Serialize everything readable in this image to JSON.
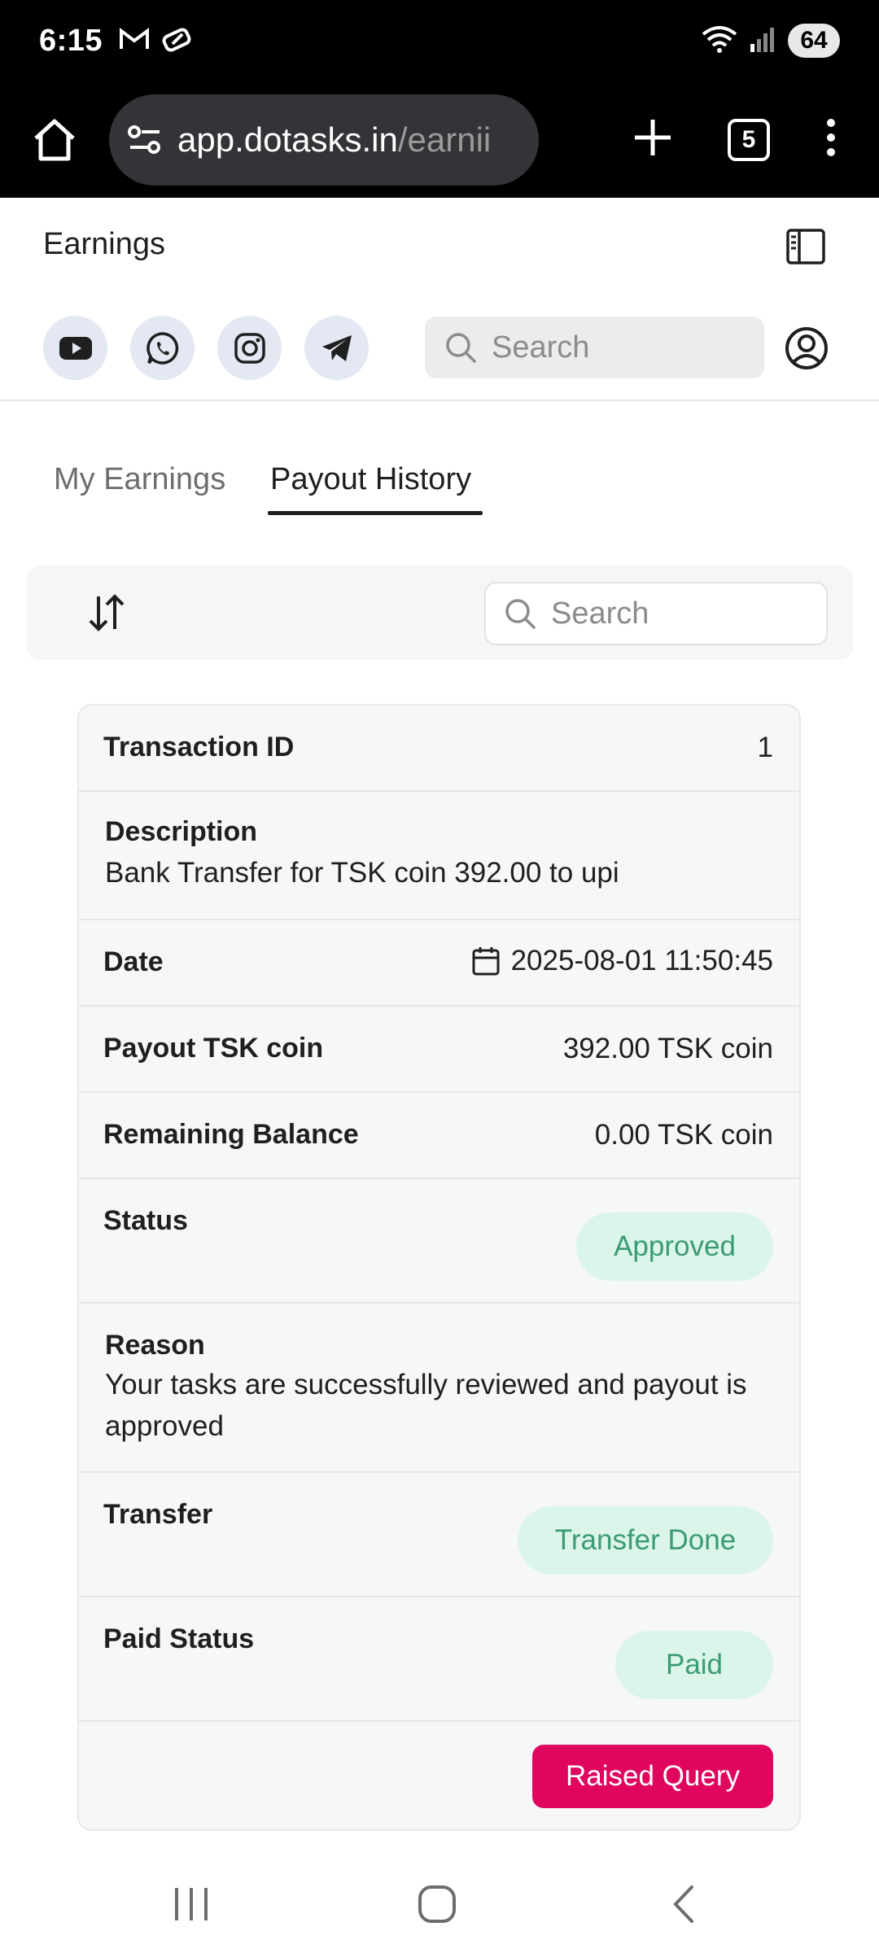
{
  "status_bar": {
    "time": "6:15",
    "battery": "64"
  },
  "browser": {
    "url_domain": "app.dotasks.in",
    "url_path": "/earnii",
    "tab_count": "5"
  },
  "header": {
    "title": "Earnings",
    "search_placeholder": "Search"
  },
  "tabs": [
    {
      "label": "My Earnings",
      "active": false
    },
    {
      "label": "Payout History",
      "active": true
    }
  ],
  "toolbar": {
    "search_placeholder": "Search"
  },
  "payout": {
    "transaction_id_label": "Transaction ID",
    "transaction_id": "1",
    "description_label": "Description",
    "description": "Bank Transfer for TSK coin 392.00 to upi",
    "date_label": "Date",
    "date": "2025-08-01 11:50:45",
    "payout_label": "Payout TSK coin",
    "payout": "392.00 TSK coin",
    "balance_label": "Remaining Balance",
    "balance": "0.00 TSK coin",
    "status_label": "Status",
    "status": "Approved",
    "reason_label": "Reason",
    "reason": "Your tasks are successfully reviewed and payout is approved",
    "transfer_label": "Transfer",
    "transfer": "Transfer Done",
    "paid_status_label": "Paid Status",
    "paid_status": "Paid",
    "raised_query_label": "Raised Query"
  },
  "colors": {
    "accent": "#e0065f",
    "status_pill_bg": "#dcf5ea",
    "status_pill_text": "#3b9b73",
    "social_bg": "#e3e8f2"
  },
  "icons": [
    "gmail-icon",
    "wallet-icon",
    "wifi-icon",
    "signal-icon",
    "home-icon",
    "site-settings-icon",
    "plus-icon",
    "more-icon",
    "sidebar-toggle-icon",
    "youtube-icon",
    "whatsapp-icon",
    "instagram-icon",
    "telegram-icon",
    "search-icon",
    "profile-icon",
    "sort-icon",
    "calendar-icon",
    "recents-icon",
    "nav-home-icon",
    "back-icon"
  ]
}
